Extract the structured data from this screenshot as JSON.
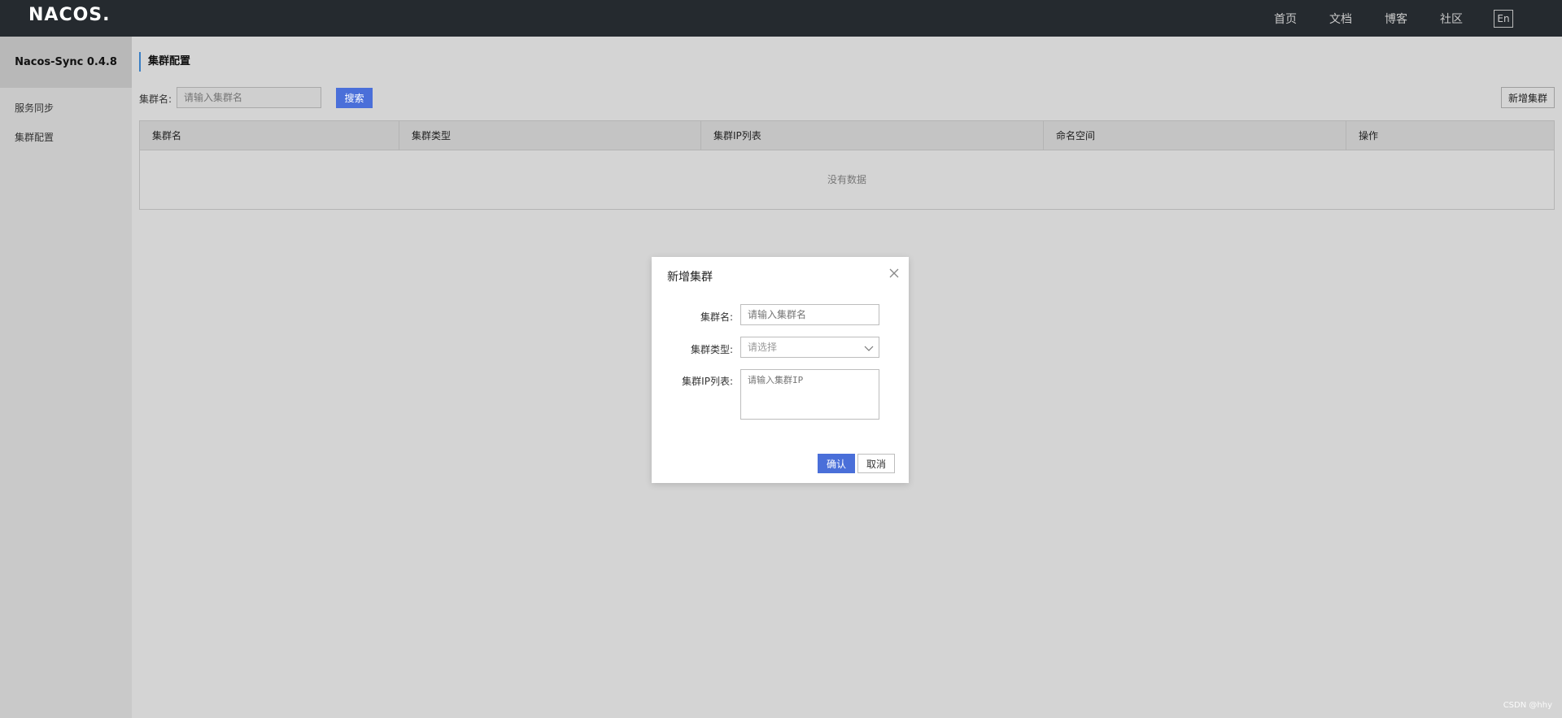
{
  "header": {
    "logo": "NACOS.",
    "nav": [
      "首页",
      "文档",
      "博客",
      "社区"
    ],
    "lang": "En"
  },
  "sidebar": {
    "brand": "Nacos-Sync 0.4.8",
    "items": [
      {
        "label": "服务同步"
      },
      {
        "label": "集群配置"
      }
    ]
  },
  "main": {
    "page_title": "集群配置",
    "search": {
      "label": "集群名:",
      "placeholder": "请输入集群名",
      "button": "搜索"
    },
    "add_button": "新增集群",
    "table": {
      "columns": [
        "集群名",
        "集群类型",
        "集群IP列表",
        "命名空间",
        "操作"
      ],
      "empty_text": "没有数据"
    }
  },
  "dialog": {
    "title": "新增集群",
    "fields": {
      "name_label": "集群名:",
      "name_placeholder": "请输入集群名",
      "type_label": "集群类型:",
      "type_placeholder": "请选择",
      "ip_label": "集群IP列表:",
      "ip_placeholder": "请输入集群IP"
    },
    "ok": "确认",
    "cancel": "取消"
  },
  "watermark": "CSDN @hhy",
  "colors": {
    "header_bg": "#252a2f",
    "primary": "#4a6fd9",
    "title_accent": "#3b7fc4"
  }
}
